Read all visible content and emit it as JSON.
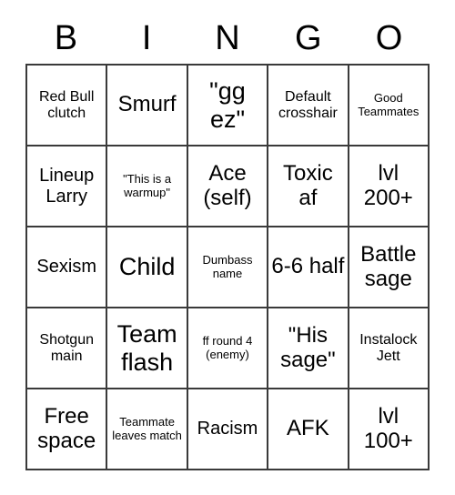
{
  "card": {
    "headers": [
      "B",
      "I",
      "N",
      "G",
      "O"
    ],
    "cells": [
      [
        {
          "text": "Red Bull clutch",
          "size": "sm"
        },
        {
          "text": "Smurf",
          "size": "lg"
        },
        {
          "text": "\"gg ez\"",
          "size": "xl"
        },
        {
          "text": "Default crosshair",
          "size": "sm"
        },
        {
          "text": "Good Teammates",
          "size": "xs"
        }
      ],
      [
        {
          "text": "Lineup Larry",
          "size": "md"
        },
        {
          "text": "\"This is a warmup\"",
          "size": "xs"
        },
        {
          "text": "Ace (self)",
          "size": "lg"
        },
        {
          "text": "Toxic af",
          "size": "lg"
        },
        {
          "text": "lvl 200+",
          "size": "lg"
        }
      ],
      [
        {
          "text": "Sexism",
          "size": "md"
        },
        {
          "text": "Child",
          "size": "xl"
        },
        {
          "text": "Dumbass name",
          "size": "xs"
        },
        {
          "text": "6-6 half",
          "size": "lg"
        },
        {
          "text": "Battle sage",
          "size": "lg"
        }
      ],
      [
        {
          "text": "Shotgun main",
          "size": "sm"
        },
        {
          "text": "Team flash",
          "size": "xl"
        },
        {
          "text": "ff round 4 (enemy)",
          "size": "xs"
        },
        {
          "text": "\"His sage\"",
          "size": "lg"
        },
        {
          "text": "Instalock Jett",
          "size": "sm"
        }
      ],
      [
        {
          "text": "Free space",
          "size": "lg"
        },
        {
          "text": "Teammate leaves match",
          "size": "xs"
        },
        {
          "text": "Racism",
          "size": "md"
        },
        {
          "text": "AFK",
          "size": "lg"
        },
        {
          "text": "lvl 100+",
          "size": "lg"
        }
      ]
    ]
  }
}
